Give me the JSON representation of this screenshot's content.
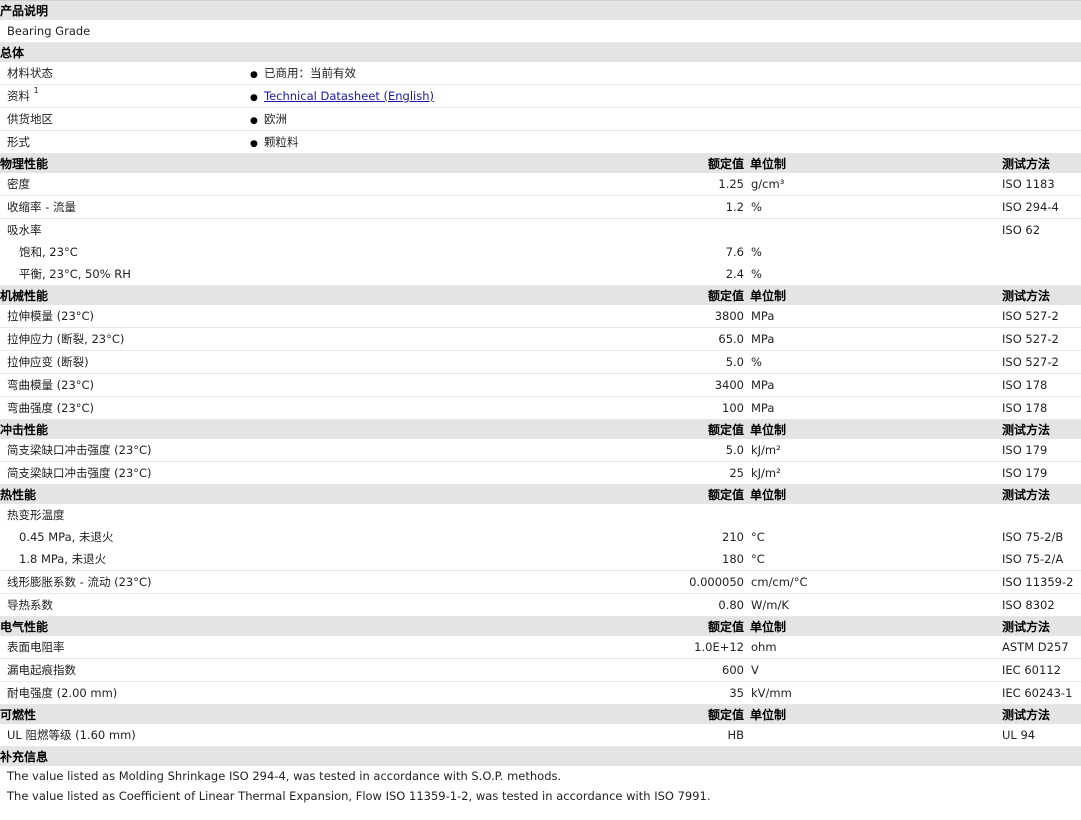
{
  "product": {
    "section_title": "产品说明",
    "description": "Bearing Grade"
  },
  "general": {
    "section_title": "总体",
    "rows": [
      {
        "label": "材料状态",
        "value": "已商用：当前有效"
      },
      {
        "label": "资料",
        "sup": "1",
        "value": "Technical Datasheet (English)",
        "is_link": true
      },
      {
        "label": "供货地区",
        "value": "欧洲"
      },
      {
        "label": "形式",
        "value": "颗粒料"
      }
    ]
  },
  "headers": {
    "value": "额定值",
    "unit": "单位制",
    "method": "测试方法"
  },
  "physical": {
    "section_title": "物理性能",
    "rows": [
      {
        "label": "密度",
        "value": "1.25",
        "unit": "g/cm³",
        "method": "ISO 1183"
      },
      {
        "label": "收缩率 - 流量",
        "value": "1.2",
        "unit": "%",
        "method": "ISO 294-4"
      },
      {
        "label": "吸水率",
        "value": "",
        "unit": "",
        "method": "ISO 62"
      },
      {
        "label": "饱和, 23°C",
        "value": "7.6",
        "unit": "%",
        "method": "",
        "sub": true
      },
      {
        "label": "平衡, 23°C, 50% RH",
        "value": "2.4",
        "unit": "%",
        "method": "",
        "sub": true
      }
    ]
  },
  "mechanical": {
    "section_title": "机械性能",
    "rows": [
      {
        "label": "拉伸模量 (23°C)",
        "value": "3800",
        "unit": "MPa",
        "method": "ISO 527-2"
      },
      {
        "label": "拉伸应力 (断裂, 23°C)",
        "value": "65.0",
        "unit": "MPa",
        "method": "ISO 527-2"
      },
      {
        "label": "拉伸应变 (断裂)",
        "value": "5.0",
        "unit": "%",
        "method": "ISO 527-2"
      },
      {
        "label": "弯曲模量 (23°C)",
        "value": "3400",
        "unit": "MPa",
        "method": "ISO 178"
      },
      {
        "label": "弯曲强度 (23°C)",
        "value": "100",
        "unit": "MPa",
        "method": "ISO 178"
      }
    ]
  },
  "impact": {
    "section_title": "冲击性能",
    "rows": [
      {
        "label": "简支梁缺口冲击强度 (23°C)",
        "value": "5.0",
        "unit": "kJ/m²",
        "method": "ISO 179"
      },
      {
        "label": "简支梁缺口冲击强度 (23°C)",
        "value": "25",
        "unit": "kJ/m²",
        "method": "ISO 179"
      }
    ]
  },
  "thermal": {
    "section_title": "热性能",
    "rows": [
      {
        "label": "热变形温度",
        "value": "",
        "unit": "",
        "method": ""
      },
      {
        "label": "0.45 MPa, 未退火",
        "value": "210",
        "unit": "°C",
        "method": "ISO 75-2/B",
        "sub": true
      },
      {
        "label": "1.8 MPa, 未退火",
        "value": "180",
        "unit": "°C",
        "method": "ISO 75-2/A",
        "sub": true
      },
      {
        "label": "线形膨胀系数 - 流动 (23°C)",
        "value": "0.000050",
        "unit": "cm/cm/°C",
        "method": "ISO 11359-2"
      },
      {
        "label": "导热系数",
        "value": "0.80",
        "unit": "W/m/K",
        "method": "ISO 8302"
      }
    ]
  },
  "electrical": {
    "section_title": "电气性能",
    "rows": [
      {
        "label": "表面电阻率",
        "value": "1.0E+12",
        "unit": "ohm",
        "method": "ASTM D257"
      },
      {
        "label": "漏电起痕指数",
        "value": "600",
        "unit": "V",
        "method": "IEC 60112"
      },
      {
        "label": "耐电强度 (2.00 mm)",
        "value": "35",
        "unit": "kV/mm",
        "method": "IEC 60243-1"
      }
    ]
  },
  "flammability": {
    "section_title": "可燃性",
    "rows": [
      {
        "label": "UL 阻燃等级 (1.60 mm)",
        "value": "HB",
        "unit": "",
        "method": "UL 94"
      }
    ]
  },
  "supplement": {
    "section_title": "补充信息",
    "notes": [
      "The value listed as Molding Shrinkage ISO 294-4, was tested in accordance with S.O.P. methods.",
      "The value listed as Coefficient of Linear Thermal Expansion, Flow ISO 11359-1-2, was tested in accordance with ISO 7991."
    ]
  }
}
